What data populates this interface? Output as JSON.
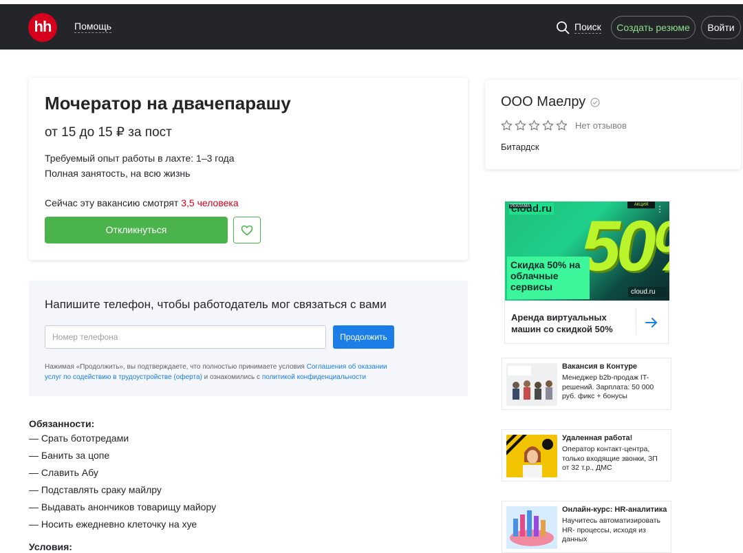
{
  "header": {
    "logo_text": "hh",
    "help_label": "Помощь",
    "search_label": "Поиск",
    "create_resume_label": "Создать резюме",
    "login_label": "Войти"
  },
  "vacancy": {
    "title": "Мочератор на двачепарашу",
    "salary": "от 15 до 15 ₽ за пост",
    "experience": "Требуемый опыт работы в лахте: 1–3 года",
    "employment": "Полная занятость, на всю жизнь",
    "viewers_prefix": "Сейчас эту вакансию смотрят ",
    "viewers_count": "3,5 человека",
    "apply_label": "Откликнуться"
  },
  "phone_form": {
    "title": "Напишите телефон, чтобы работодатель мог связаться с вами",
    "input_placeholder": "Номер телефона",
    "input_value": "",
    "continue_label": "Продолжить",
    "terms_prefix": "Нажимая «Продолжить», вы подтверждаете, что полностью принимаете условия ",
    "terms_link1": "Соглашения об оказании услуг по содействию в трудоустройстве (оферта)",
    "terms_middle": " и ознакомились с ",
    "terms_link2": "политикой конфиденциальности"
  },
  "duties": {
    "title": "Обязанности:",
    "items": [
      "— Срать бототредами",
      "— Банить за цопе",
      "— Славить Абу",
      "— Подставлять сраку майлру",
      "— Выдавать анончиков товарищу майору",
      "— Носить ежедневно клеточку на хуе"
    ]
  },
  "conditions": {
    "title": "Условия:"
  },
  "company": {
    "name": "ООО Маелру",
    "reviews_label": "Нет отзывов",
    "rating": 0,
    "rating_max": 5,
    "city": "Битардск"
  },
  "ad_main": {
    "logo": "cloud.ru",
    "promo_tag": "РЕКЛАМА",
    "akcia": "АКЦИЯ",
    "big_number": "50%",
    "discount_text": "Скидка 50% на облачные сервисы",
    "badge": "cloud.ru",
    "caption": "Аренда виртуальных машин со скидкой 50%"
  },
  "ads_small": [
    {
      "title": "Вакансия в Контуре",
      "text": "Менеджер b2b-продаж IT-решений. Зарплата: 50 000 руб. фикс + бонусы"
    },
    {
      "title": "Удаленная работа!",
      "text": "Оператор контакт-центра, только входящие звонки, ЗП от 32 т.р., ДМС"
    },
    {
      "title": "Онлайн-курс: HR-аналитика",
      "text": "Научитесь автоматизировать HR- процессы, исходя из данных"
    }
  ],
  "colors": {
    "header_bg": "#232529",
    "brand_red": "#d6001c",
    "apply_green": "#4bb34b",
    "link_blue": "#1a7ee6"
  }
}
